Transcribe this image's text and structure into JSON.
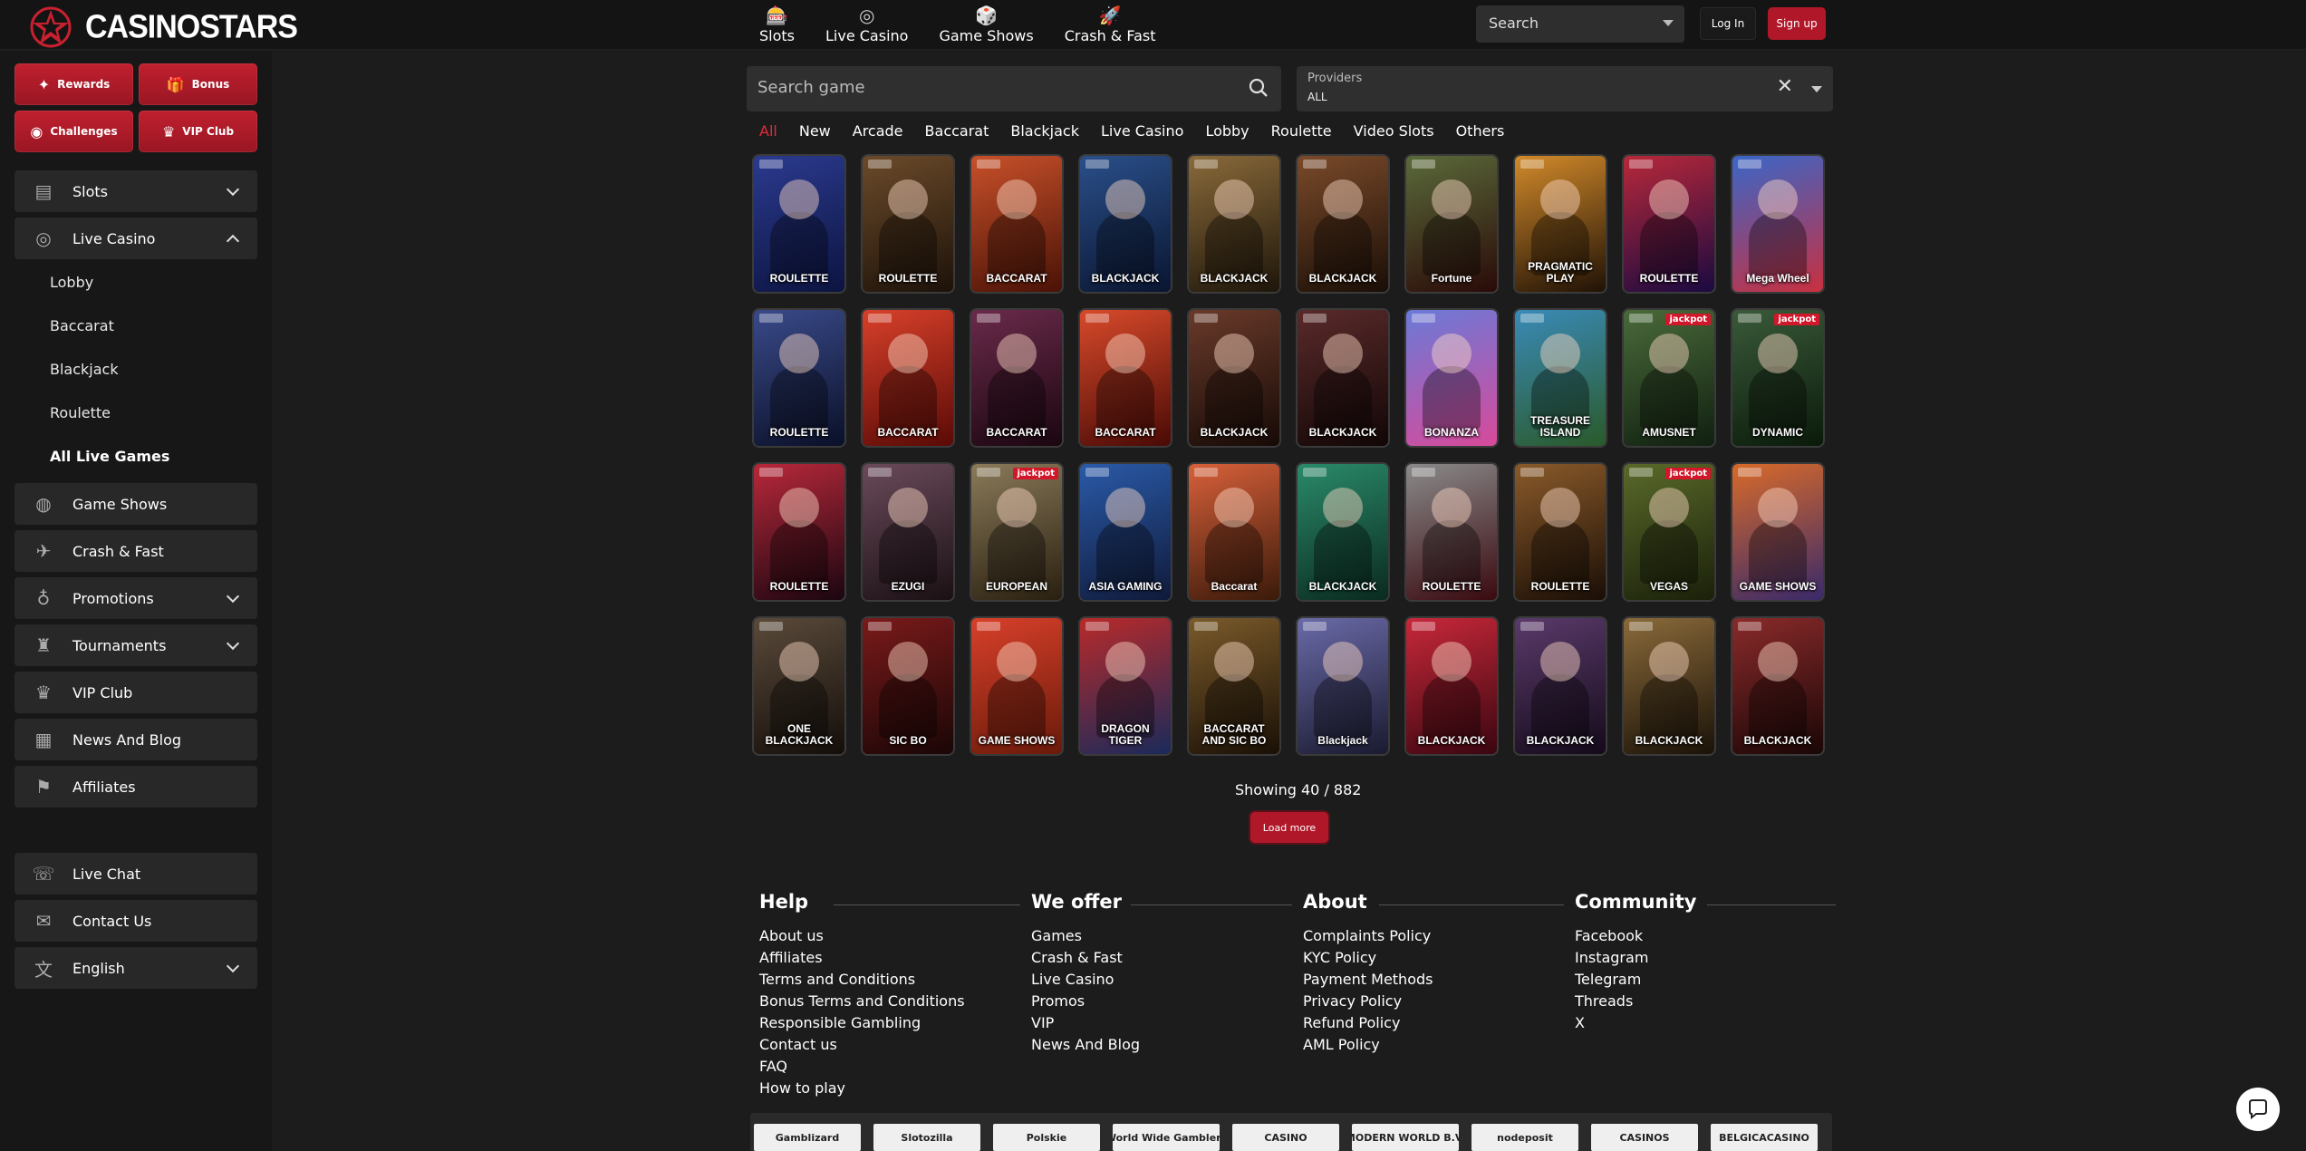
{
  "brand": {
    "name": "CASINOSTARS",
    "accent": "#b0182a",
    "active_filter_color": "#e32c3b"
  },
  "topnav": [
    {
      "label": "Slots",
      "icon": "slots-icon",
      "glyph": "🎰"
    },
    {
      "label": "Live Casino",
      "icon": "live-casino-icon",
      "glyph": "◎"
    },
    {
      "label": "Game Shows",
      "icon": "game-shows-icon",
      "glyph": "🎲"
    },
    {
      "label": "Crash & Fast",
      "icon": "crash-fast-icon",
      "glyph": "🚀"
    }
  ],
  "header": {
    "search_label": "Search",
    "login": "Log In",
    "signup": "Sign up"
  },
  "sidebar": {
    "rewards": [
      {
        "label": "Rewards",
        "glyph": "✦"
      },
      {
        "label": "Bonus",
        "glyph": "🎁"
      },
      {
        "label": "Challenges",
        "glyph": "◉"
      },
      {
        "label": "VIP Club",
        "glyph": "♛"
      }
    ],
    "menu": [
      {
        "label": "Slots",
        "glyph": "▤",
        "chevron": "down"
      },
      {
        "label": "Live Casino",
        "glyph": "◎",
        "chevron": "up"
      },
      {
        "label": "Game Shows",
        "glyph": "◍",
        "chevron": ""
      },
      {
        "label": "Crash & Fast",
        "glyph": "✈",
        "chevron": ""
      },
      {
        "label": "Promotions",
        "glyph": "♁",
        "chevron": "down"
      },
      {
        "label": "Tournaments",
        "glyph": "♜",
        "chevron": "down"
      },
      {
        "label": "VIP Club",
        "glyph": "♛",
        "chevron": ""
      },
      {
        "label": "News And Blog",
        "glyph": "▦",
        "chevron": ""
      },
      {
        "label": "Affiliates",
        "glyph": "⚑",
        "chevron": ""
      }
    ],
    "live_casino_sub": [
      "Lobby",
      "Baccarat",
      "Blackjack",
      "Roulette",
      "All Live Games"
    ],
    "bottom": [
      {
        "label": "Live Chat",
        "glyph": "☏",
        "chevron": ""
      },
      {
        "label": "Contact Us",
        "glyph": "✉",
        "chevron": ""
      },
      {
        "label": "English",
        "glyph": "文",
        "chevron": "down"
      }
    ]
  },
  "search_game": {
    "placeholder": "Search game"
  },
  "providers": {
    "label": "Providers",
    "value": "ALL"
  },
  "filters": [
    "All",
    "New",
    "Arcade",
    "Baccarat",
    "Blackjack",
    "Live Casino",
    "Lobby",
    "Roulette",
    "Video Slots",
    "Others"
  ],
  "games": [
    {
      "title": "ROULETTE",
      "color": "#2b3a8f",
      "color2": "#0c1440",
      "badge": ""
    },
    {
      "title": "ROULETTE",
      "color": "#6b4a2a",
      "color2": "#1d1209",
      "badge": ""
    },
    {
      "title": "BACCARAT",
      "color": "#c8502a",
      "color2": "#4a1206",
      "badge": ""
    },
    {
      "title": "BLACKJACK",
      "color": "#2a4f8a",
      "color2": "#0a1530",
      "badge": ""
    },
    {
      "title": "BLACKJACK",
      "color": "#8a6a3a",
      "color2": "#1e160a",
      "badge": ""
    },
    {
      "title": "BLACKJACK",
      "color": "#7a4a2a",
      "color2": "#1a0e06",
      "badge": ""
    },
    {
      "title": "Fortune",
      "color": "#5a6a3a",
      "color2": "#2a0a08",
      "badge": ""
    },
    {
      "title": "PRAGMATIC PLAY",
      "color": "#d28a2a",
      "color2": "#201206",
      "badge": ""
    },
    {
      "title": "ROULETTE",
      "color": "#b8283a",
      "color2": "#1a0a40",
      "badge": ""
    },
    {
      "title": "Mega Wheel",
      "color": "#3a66c8",
      "color2": "#c83040",
      "badge": ""
    },
    {
      "title": "ROULETTE",
      "color": "#3a4a8a",
      "color2": "#0a1028",
      "badge": ""
    },
    {
      "title": "BACCARAT",
      "color": "#d8402a",
      "color2": "#5a0a06",
      "badge": ""
    },
    {
      "title": "BACCARAT",
      "color": "#6a2a4a",
      "color2": "#1a0610",
      "badge": ""
    },
    {
      "title": "BACCARAT",
      "color": "#d84a2a",
      "color2": "#4a0a06",
      "badge": ""
    },
    {
      "title": "BLACKJACK",
      "color": "#6a3a2a",
      "color2": "#160a06",
      "badge": ""
    },
    {
      "title": "BLACKJACK",
      "color": "#5a2a2a",
      "color2": "#120606",
      "badge": ""
    },
    {
      "title": "BONANZA",
      "color": "#6a7ad8",
      "color2": "#d84a9a",
      "badge": ""
    },
    {
      "title": "TREASURE ISLAND",
      "color": "#3a8ab8",
      "color2": "#2a5a2a",
      "badge": ""
    },
    {
      "title": "AMUSNET",
      "color": "#4a6a3a",
      "color2": "#102010",
      "badge": "jackpot"
    },
    {
      "title": "DYNAMIC",
      "color": "#3a5a3a",
      "color2": "#0a1a0a",
      "badge": "jackpot"
    },
    {
      "title": "ROULETTE",
      "color": "#b8283a",
      "color2": "#1a0610",
      "badge": ""
    },
    {
      "title": "EZUGI",
      "color": "#6a4a5a",
      "color2": "#1a1014",
      "badge": ""
    },
    {
      "title": "EUROPEAN",
      "color": "#8a7a5a",
      "color2": "#2a2010",
      "badge": "jackpot"
    },
    {
      "title": "ASIA GAMING",
      "color": "#2a5aa8",
      "color2": "#101a3a",
      "badge": ""
    },
    {
      "title": "Baccarat",
      "color": "#d8603a",
      "color2": "#3a1a0a",
      "badge": ""
    },
    {
      "title": "BLACKJACK",
      "color": "#2a8a6a",
      "color2": "#0a2a20",
      "badge": ""
    },
    {
      "title": "ROULETTE",
      "color": "#8a8a8a",
      "color2": "#3a0a10",
      "badge": ""
    },
    {
      "title": "ROULETTE",
      "color": "#8a5a2a",
      "color2": "#1a0e06",
      "badge": ""
    },
    {
      "title": "VEGAS",
      "color": "#5a6a2a",
      "color2": "#1a200a",
      "badge": "jackpot"
    },
    {
      "title": "GAME SHOWS",
      "color": "#d86a2a",
      "color2": "#3a2a6a",
      "badge": ""
    },
    {
      "title": "ONE BLACKJACK",
      "color": "#5a4a3a",
      "color2": "#140e0a",
      "badge": ""
    },
    {
      "title": "SIC BO",
      "color": "#7a1a1a",
      "color2": "#1a0606",
      "badge": ""
    },
    {
      "title": "GAME SHOWS",
      "color": "#d8402a",
      "color2": "#6a1a0a",
      "badge": ""
    },
    {
      "title": "DRAGON TIGER",
      "color": "#b82a2a",
      "color2": "#1a2a5a",
      "badge": ""
    },
    {
      "title": "BACCARAT AND SIC BO",
      "color": "#7a5a2a",
      "color2": "#1a1006",
      "badge": ""
    },
    {
      "title": "Blackjack",
      "color": "#6a6aa8",
      "color2": "#1a1a30",
      "badge": ""
    },
    {
      "title": "BLACKJACK",
      "color": "#c8283a",
      "color2": "#3a0610",
      "badge": ""
    },
    {
      "title": "BLACKJACK",
      "color": "#5a3a6a",
      "color2": "#140a1a",
      "badge": ""
    },
    {
      "title": "BLACKJACK",
      "color": "#8a6a3a",
      "color2": "#1a1208",
      "badge": ""
    },
    {
      "title": "BLACKJACK",
      "color": "#8a2a2a",
      "color2": "#1a0606",
      "badge": ""
    }
  ],
  "showing": "Showing 40 / 882",
  "load_more": "Load more",
  "footer": [
    {
      "heading": "Help",
      "links": [
        "About us",
        "Affiliates",
        "Terms and Conditions",
        "Bonus Terms and Conditions",
        "Responsible Gambling",
        "Contact us",
        "FAQ",
        "How to play"
      ]
    },
    {
      "heading": "We offer",
      "links": [
        "Games",
        "Crash & Fast",
        "Live Casino",
        "Promos",
        "VIP",
        "News And Blog"
      ]
    },
    {
      "heading": "About",
      "links": [
        "Complaints Policy",
        "KYC Policy",
        "Payment Methods",
        "Privacy Policy",
        "Refund Policy",
        "AML Policy"
      ]
    },
    {
      "heading": "Community",
      "links": [
        "Facebook",
        "Instagram",
        "Telegram",
        "Threads",
        "X"
      ]
    }
  ],
  "partners": [
    "Gamblizard",
    "Slotozilla",
    "Polskie",
    "World Wide Gamblers",
    "CASINO",
    "MODERN WORLD B.V.",
    "nodeposit",
    "CASINOS",
    "BELGICACASINO"
  ]
}
